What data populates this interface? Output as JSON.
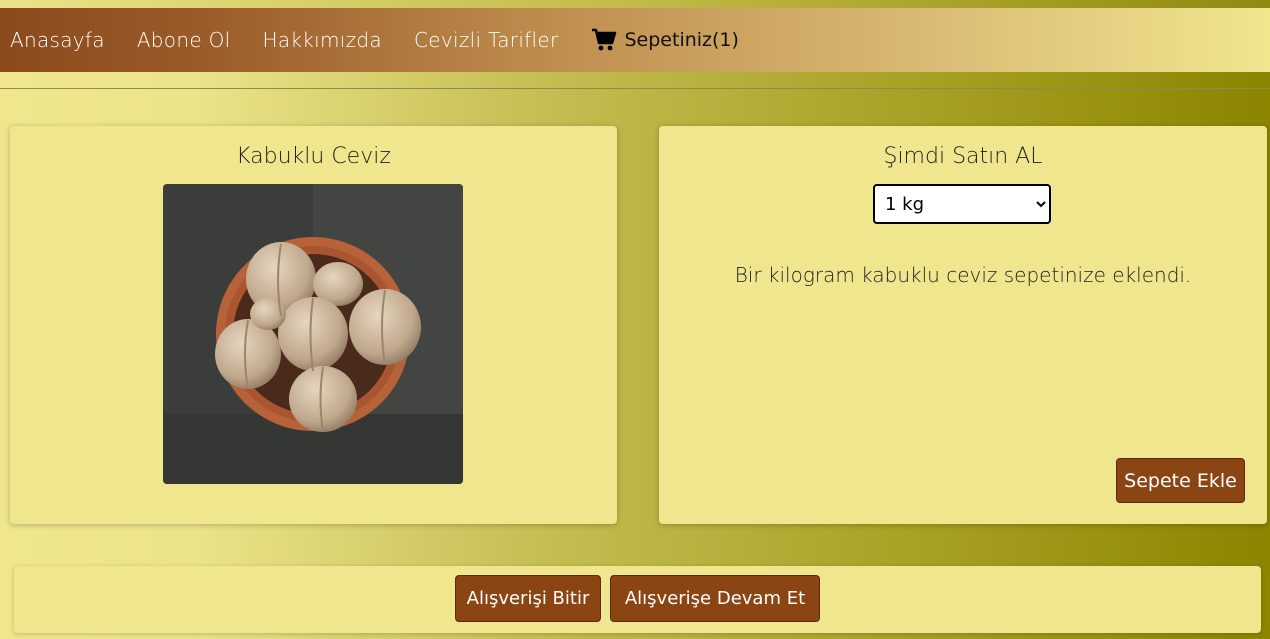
{
  "nav": {
    "items": [
      {
        "label": "Anasayfa"
      },
      {
        "label": "Abone Ol"
      },
      {
        "label": "Hakkımızda"
      },
      {
        "label": "Cevizli Tarifler"
      }
    ],
    "cart_label": "Sepetiniz(1)",
    "cart_icon": "shopping-cart-icon"
  },
  "product": {
    "title": "Kabuklu Ceviz",
    "image_alt": "walnuts-in-bowl"
  },
  "purchase": {
    "title": "Şimdi Satın AL",
    "quantity_selected": "1 kg",
    "message": "Bir kilogram kabuklu ceviz sepetinize eklendi.",
    "add_button": "Sepete Ekle"
  },
  "footer": {
    "finish_button": "Alışverişi Bitir",
    "continue_button": "Alışverişe Devam Et"
  },
  "colors": {
    "brand_brown": "#8b4513",
    "card_bg": "#efe68e",
    "olive": "#8c8500"
  }
}
